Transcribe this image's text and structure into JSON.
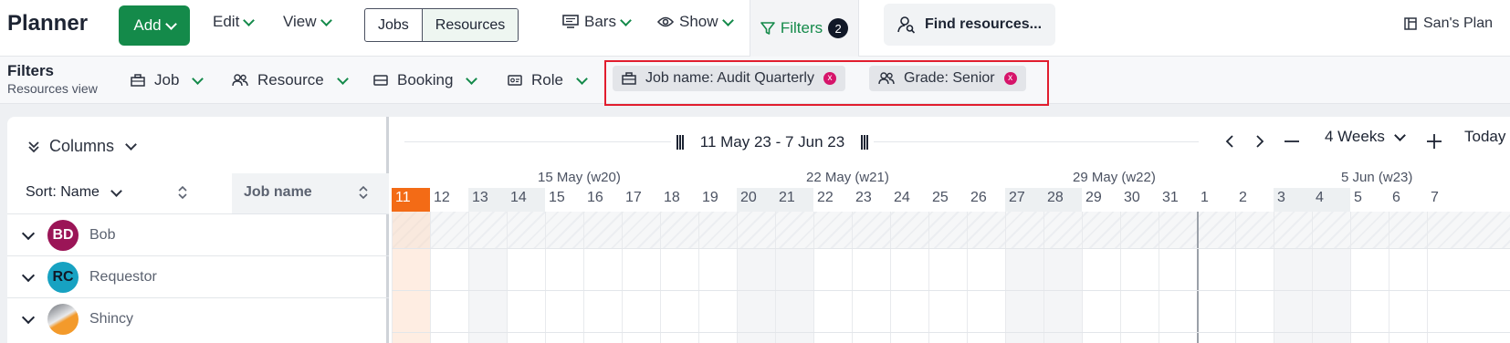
{
  "app": {
    "title": "Planner"
  },
  "toolbar": {
    "add_label": "Add",
    "edit_label": "Edit",
    "view_label": "View",
    "view_toggle": [
      "Jobs",
      "Resources"
    ],
    "bars_label": "Bars",
    "show_label": "Show",
    "filters_label": "Filters",
    "filters_count": "2",
    "find_label": "Find resources...",
    "plan_label": "San's Plan"
  },
  "filterbar": {
    "title": "Filters",
    "subtitle": "Resources view",
    "menus": [
      "Job",
      "Resource",
      "Booking",
      "Role"
    ],
    "chips": [
      "Job name: Audit Quarterly",
      "Grade: Senior"
    ],
    "chip_close": "x"
  },
  "grid": {
    "columns_label": "Columns",
    "sort_label": "Sort: Name",
    "jobname_header": "Job name",
    "rows": [
      {
        "initials": "BD",
        "name": "Bob",
        "color": "#9b1557",
        "text_color": "#ffffff"
      },
      {
        "initials": "RC",
        "name": "Requestor",
        "color": "#17a2c2",
        "text_color": "#111827"
      },
      {
        "initials": "",
        "name": "Shincy",
        "color": "#f39a2b",
        "text_color": "#ffffff"
      }
    ]
  },
  "timeline": {
    "range_label": "11 May 23 - 7 Jun 23",
    "zoom_label": "4 Weeks",
    "today_label": "Today",
    "weeks": [
      "15 May (w20)",
      "22 May (w21)",
      "29 May (w22)",
      "5 Jun (w23)"
    ],
    "days": [
      "11",
      "12",
      "13",
      "14",
      "15",
      "16",
      "17",
      "18",
      "19",
      "20",
      "21",
      "22",
      "23",
      "24",
      "25",
      "26",
      "27",
      "28",
      "29",
      "30",
      "31",
      "1",
      "2",
      "3",
      "4",
      "5",
      "6",
      "7"
    ]
  }
}
